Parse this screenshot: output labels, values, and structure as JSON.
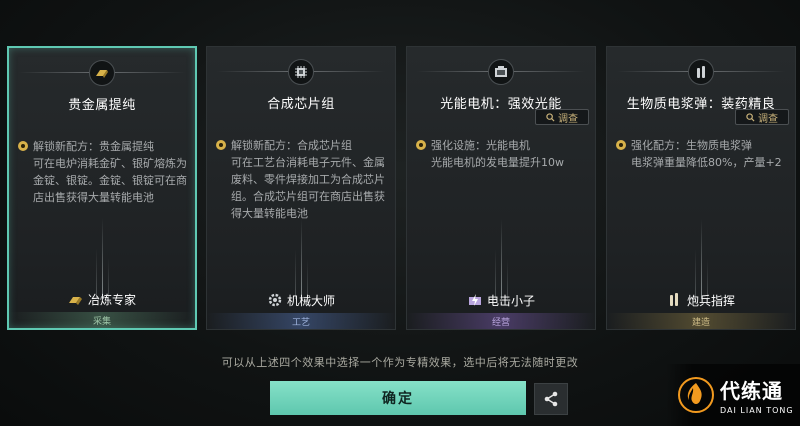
{
  "cards": [
    {
      "title": "贵金属提纯",
      "description": "解锁新配方：贵金属提纯\n可在电炉消耗金矿、银矿熔炼为金锭、银锭。金锭、银锭可在商店出售获得大量转能电池",
      "skill": "冶炼专家",
      "category": "采集",
      "icon": "gold-bar-icon",
      "selected": true
    },
    {
      "title": "合成芯片组",
      "description": "解锁新配方：合成芯片组\n可在工艺台消耗电子元件、金属废料、零件焊接加工为合成芯片组。合成芯片组可在商店出售获得大量转能电池",
      "skill": "机械大师",
      "category": "工艺",
      "icon": "chip-icon",
      "selected": false
    },
    {
      "title": "光能电机：强效光能",
      "inspect": "调查",
      "description": "强化设施：光能电机\n光能电机的发电量提升10w",
      "skill": "电击小子",
      "category": "经营",
      "icon": "generator-icon",
      "selected": false
    },
    {
      "title": "生物质电浆弹：装药精良",
      "inspect": "调查",
      "description": "强化配方：生物质电浆弹\n电浆弹重量降低80%，产量+2",
      "skill": "炮兵指挥",
      "category": "建造",
      "icon": "shell-icon",
      "selected": false
    }
  ],
  "hint": "可以从上述四个效果中选择一个作为专精效果，选中后将无法随时更改",
  "confirm_label": "确定",
  "share_icon": "share-icon",
  "logo": {
    "cn": "代练通",
    "en": "DAI LIAN TONG"
  },
  "colors": {
    "accent": "#5ec7ae",
    "gold": "#d8b24a"
  }
}
